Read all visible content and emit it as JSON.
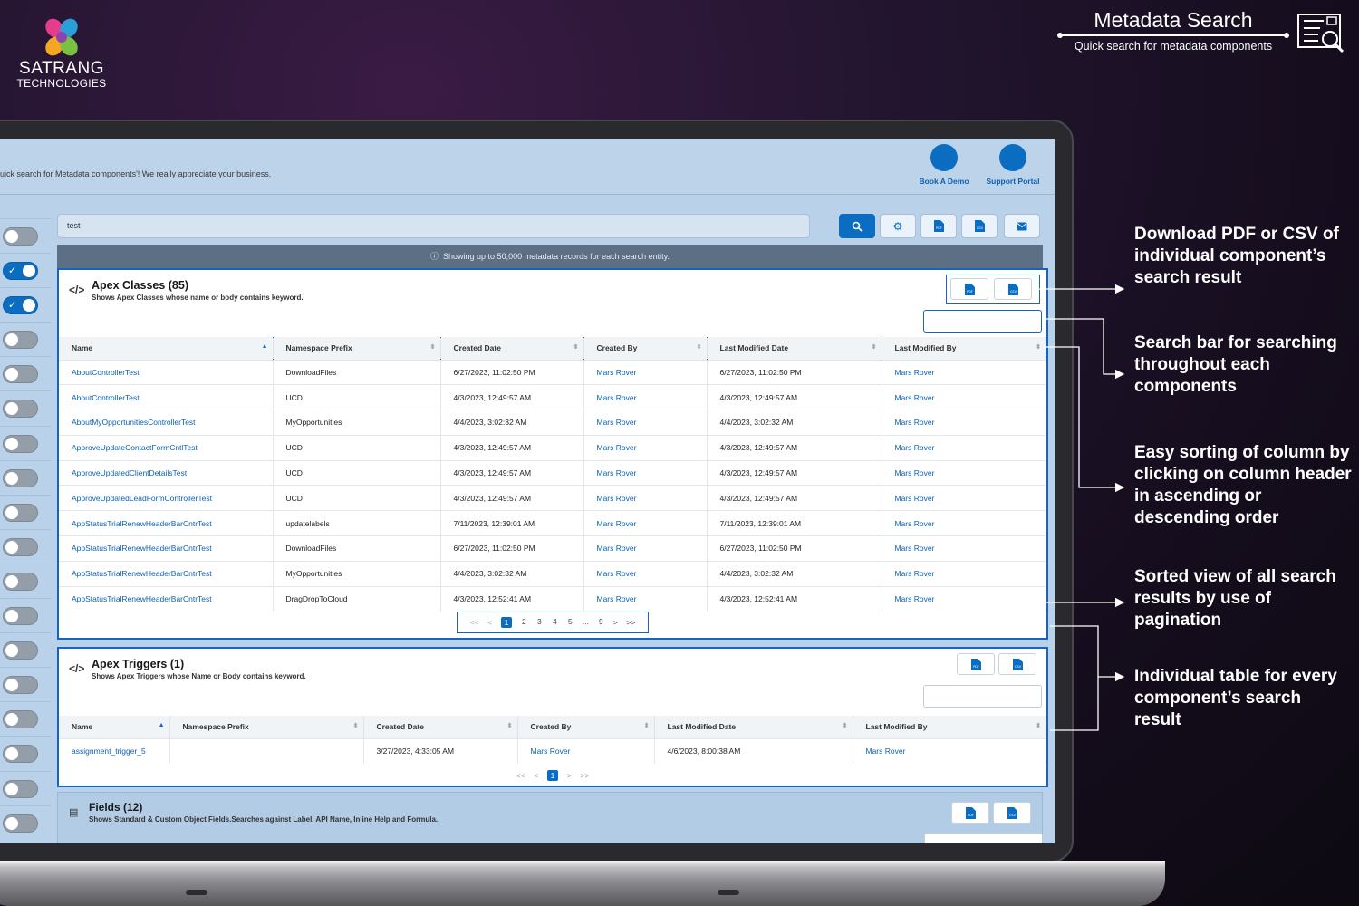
{
  "brand": {
    "name_line1": "SATRANG",
    "name_line2": "TECHNOLOGIES"
  },
  "hero": {
    "title": "Metadata Search",
    "subtitle": "Quick search for metadata components",
    "icon": "document-search-icon"
  },
  "app": {
    "thanks_message": "uick search for Metadata components'! We really appreciate your business.",
    "book_demo": "Book A Demo",
    "support_portal": "Support Portal",
    "search_value": "test",
    "banner": "Showing up to 50,000 metadata records for each search entity.",
    "toolbar_icons": [
      "search-icon",
      "gear-icon",
      "pdf-icon",
      "csv-icon",
      "email-icon"
    ],
    "toggles": [
      false,
      true,
      true,
      false,
      false,
      false,
      false,
      false,
      false,
      false,
      false,
      false,
      false,
      false,
      false,
      false,
      false,
      false,
      false,
      false,
      true,
      false
    ]
  },
  "apex_classes": {
    "title": "Apex Classes (85)",
    "subtitle": "Shows Apex Classes whose name or body contains keyword.",
    "columns": [
      "Name",
      "Namespace Prefix",
      "Created Date",
      "Created By",
      "Last Modified Date",
      "Last Modified By"
    ],
    "rows": [
      [
        "AboutControllerTest",
        "DownloadFiles",
        "6/27/2023, 11:02:50 PM",
        "Mars Rover",
        "6/27/2023, 11:02:50 PM",
        "Mars Rover"
      ],
      [
        "AboutControllerTest",
        "UCD",
        "4/3/2023, 12:49:57 AM",
        "Mars Rover",
        "4/3/2023, 12:49:57 AM",
        "Mars Rover"
      ],
      [
        "AboutMyOpportunitiesControllerTest",
        "MyOpportunities",
        "4/4/2023, 3:02:32 AM",
        "Mars Rover",
        "4/4/2023, 3:02:32 AM",
        "Mars Rover"
      ],
      [
        "ApproveUpdateContactFormCntlTest",
        "UCD",
        "4/3/2023, 12:49:57 AM",
        "Mars Rover",
        "4/3/2023, 12:49:57 AM",
        "Mars Rover"
      ],
      [
        "ApproveUpdatedClientDetailsTest",
        "UCD",
        "4/3/2023, 12:49:57 AM",
        "Mars Rover",
        "4/3/2023, 12:49:57 AM",
        "Mars Rover"
      ],
      [
        "ApproveUpdatedLeadFormControllerTest",
        "UCD",
        "4/3/2023, 12:49:57 AM",
        "Mars Rover",
        "4/3/2023, 12:49:57 AM",
        "Mars Rover"
      ],
      [
        "AppStatusTrialRenewHeaderBarCntrTest",
        "updatelabels",
        "7/11/2023, 12:39:01 AM",
        "Mars Rover",
        "7/11/2023, 12:39:01 AM",
        "Mars Rover"
      ],
      [
        "AppStatusTrialRenewHeaderBarCntrTest",
        "DownloadFiles",
        "6/27/2023, 11:02:50 PM",
        "Mars Rover",
        "6/27/2023, 11:02:50 PM",
        "Mars Rover"
      ],
      [
        "AppStatusTrialRenewHeaderBarCntrTest",
        "MyOpportunities",
        "4/4/2023, 3:02:32 AM",
        "Mars Rover",
        "4/4/2023, 3:02:32 AM",
        "Mars Rover"
      ],
      [
        "AppStatusTrialRenewHeaderBarCntrTest",
        "DragDropToCloud",
        "4/3/2023, 12:52:41 AM",
        "Mars Rover",
        "4/3/2023, 12:52:41 AM",
        "Mars Rover"
      ]
    ],
    "pager": {
      "first": "<<",
      "prev": "<",
      "pages": [
        "1",
        "2",
        "3",
        "4",
        "5",
        "...",
        "9"
      ],
      "current": "1",
      "next": ">",
      "last": ">>"
    }
  },
  "apex_triggers": {
    "title": "Apex Triggers (1)",
    "subtitle": "Shows Apex Triggers whose Name or Body contains keyword.",
    "columns": [
      "Name",
      "Namespace Prefix",
      "Created Date",
      "Created By",
      "Last Modified Date",
      "Last Modified By"
    ],
    "rows": [
      [
        "assignment_trigger_5",
        "",
        "3/27/2023, 4:33:05 AM",
        "Mars Rover",
        "4/6/2023, 8:00:38 AM",
        "Mars Rover"
      ]
    ],
    "pager": {
      "first": "<<",
      "prev": "<",
      "current": "1",
      "next": ">",
      "last": ">>"
    }
  },
  "fields": {
    "title": "Fields (12)",
    "subtitle": "Shows Standard & Custom Object Fields.Searches against Label, API Name, Inline Help and Formula."
  },
  "pdf_label": "PDF",
  "csv_label": "CSV",
  "annotations": [
    "Download PDF or CSV of individual component’s search result",
    "Search bar for searching throughout each components",
    "Easy sorting of column by clicking on column header in ascending or descending order",
    "Sorted view of all search results by use of pagination",
    "Individual table for every component’s search result"
  ],
  "colors": {
    "accent": "#0b6dc1",
    "highlight": "#1565c0",
    "screen_bg": "#b9d2ea"
  }
}
